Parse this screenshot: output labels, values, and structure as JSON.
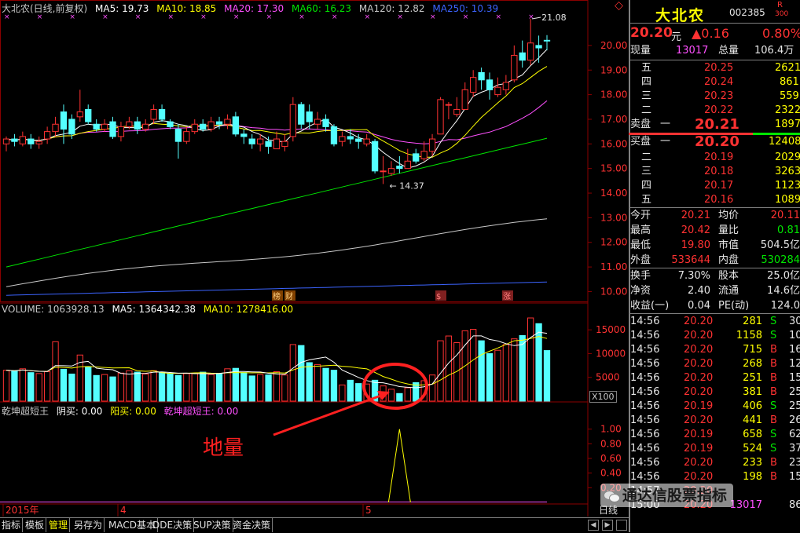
{
  "header": {
    "title": "大北农(日线,前复权)",
    "ma5": "MA5: 19.73",
    "ma10": "MA10: 18.85",
    "ma20": "MA20: 17.30",
    "ma60": "MA60: 16.23",
    "ma120": "MA120: 12.82",
    "ma250": "MA250: 10.39",
    "colors": {
      "ma5": "#ffffff",
      "ma10": "#ffff00",
      "ma20": "#ff50ff",
      "ma60": "#00e600",
      "ma120": "#c8c8c8",
      "ma250": "#3c64ff"
    }
  },
  "price_axis": [
    "20.00",
    "19.00",
    "18.00",
    "17.00",
    "16.00",
    "15.00",
    "14.00",
    "13.00",
    "12.00",
    "11.00",
    "10.00"
  ],
  "price_annotations": {
    "high": "21.08",
    "low": "14.37"
  },
  "event_markers": [
    "榜",
    "财",
    "$",
    "涨"
  ],
  "volume_header": {
    "label": "VOLUME: 1063928.13",
    "ma5": "MA5: 1364342.38",
    "ma10": "MA10: 1278416.00"
  },
  "volume_axis": [
    "15000",
    "10000",
    "5000"
  ],
  "volume_unit": "X100",
  "indicator_header": {
    "name": "乾坤超短王",
    "yinmai": "阴买: 0.00",
    "yangmai": "阳买: 0.00",
    "wang": "乾坤超短王: 0.00"
  },
  "indicator_axis": [
    "1.00",
    "0.80",
    "0.60",
    "0.40",
    "0.20"
  ],
  "annotation_text": "地量",
  "time_axis": [
    "2015年",
    "4",
    "5"
  ],
  "period_label": "日线",
  "tabs": [
    "指标",
    "模板",
    "管理",
    "另存为",
    "MACD基本",
    "DDE决策",
    "SUP决策",
    "资金决策"
  ],
  "stock": {
    "name": "大北农",
    "code": "002385",
    "badge_top": "R",
    "badge_bottom": "300",
    "price": "20.20",
    "price_unit": "元",
    "change": "▲0.16",
    "pct": "0.80%"
  },
  "volume_row": {
    "label1": "现量",
    "val1": "13017",
    "label2": "总量",
    "val2": "106.4万"
  },
  "asks": [
    {
      "label": "五",
      "price": "20.25",
      "vol": "2621"
    },
    {
      "label": "四",
      "price": "20.24",
      "vol": "861"
    },
    {
      "label": "三",
      "price": "20.23",
      "vol": "559"
    },
    {
      "label": "二",
      "price": "20.22",
      "vol": "2322"
    },
    {
      "label": "一",
      "price": "20.21",
      "vol": "1897",
      "side": "卖盘"
    }
  ],
  "bids": [
    {
      "label": "一",
      "price": "20.20",
      "vol": "12408",
      "side": "买盘"
    },
    {
      "label": "二",
      "price": "20.19",
      "vol": "2029"
    },
    {
      "label": "三",
      "price": "20.18",
      "vol": "3263"
    },
    {
      "label": "四",
      "price": "20.17",
      "vol": "1123"
    },
    {
      "label": "五",
      "price": "20.16",
      "vol": "1089"
    }
  ],
  "stats": [
    {
      "l1": "今开",
      "v1": "20.21",
      "c1": "red",
      "l2": "均价",
      "v2": "20.11",
      "c2": "red"
    },
    {
      "l1": "最高",
      "v1": "20.42",
      "c1": "red",
      "l2": "量比",
      "v2": "0.81",
      "c2": "grn"
    },
    {
      "l1": "最低",
      "v1": "19.80",
      "c1": "red",
      "l2": "市值",
      "v2": "504.5亿",
      "c2": "wht"
    },
    {
      "l1": "外盘",
      "v1": "533644",
      "c1": "red",
      "l2": "内盘",
      "v2": "530284",
      "c2": "grn"
    }
  ],
  "stats2": [
    {
      "l1": "换手",
      "v1": "7.30%",
      "l2": "股本",
      "v2": "25.0亿"
    },
    {
      "l1": "净资",
      "v1": "2.40",
      "l2": "流通",
      "v2": "14.6亿"
    },
    {
      "l1": "收益(一)",
      "v1": "0.04",
      "l2": "PE(动)",
      "v2": "124.0"
    }
  ],
  "ticks": [
    {
      "t": "14:56",
      "p": "20.20",
      "v": "281",
      "s": "S",
      "n": "30"
    },
    {
      "t": "14:56",
      "p": "20.20",
      "v": "1158",
      "s": "S",
      "n": "10"
    },
    {
      "t": "14:56",
      "p": "20.20",
      "v": "715",
      "s": "B",
      "n": "16"
    },
    {
      "t": "14:56",
      "p": "20.20",
      "v": "268",
      "s": "B",
      "n": "12"
    },
    {
      "t": "14:56",
      "p": "20.20",
      "v": "251",
      "s": "B",
      "n": "15"
    },
    {
      "t": "14:56",
      "p": "20.20",
      "v": "381",
      "s": "B",
      "n": "25"
    },
    {
      "t": "14:56",
      "p": "20.19",
      "v": "406",
      "s": "S",
      "n": "25"
    },
    {
      "t": "14:56",
      "p": "20.20",
      "v": "441",
      "s": "B",
      "n": "26"
    },
    {
      "t": "14:56",
      "p": "20.19",
      "v": "658",
      "s": "S",
      "n": "62"
    },
    {
      "t": "14:56",
      "p": "20.19",
      "v": "524",
      "s": "S",
      "n": "37"
    },
    {
      "t": "14:56",
      "p": "20.20",
      "v": "233",
      "s": "B",
      "n": "23"
    },
    {
      "t": "14:56",
      "p": "20.20",
      "v": "198",
      "s": "B",
      "n": "15"
    },
    {
      "t": "14:57",
      "p": "20.20",
      "v": "",
      "s": "",
      "n": ""
    },
    {
      "t": "15:00",
      "p": "20.20",
      "v": "13017",
      "s": "",
      "n": "864"
    }
  ],
  "watermark": "通达信股票指标",
  "chart_data": {
    "type": "candlestick",
    "ylim": [
      9.6,
      21.4
    ],
    "candles": [
      [
        16.0,
        16.2,
        16.3,
        15.7
      ],
      [
        16.2,
        16.1,
        16.4,
        15.9
      ],
      [
        16.0,
        16.3,
        16.5,
        15.9
      ],
      [
        16.2,
        16.0,
        16.4,
        15.8
      ],
      [
        16.0,
        16.1,
        16.3,
        15.8
      ],
      [
        16.2,
        16.5,
        16.7,
        16.0
      ],
      [
        16.5,
        16.8,
        17.1,
        16.3
      ],
      [
        17.3,
        16.6,
        17.6,
        16.0
      ],
      [
        17.0,
        16.4,
        17.2,
        16.2
      ],
      [
        17.1,
        17.3,
        18.2,
        16.9
      ],
      [
        17.4,
        16.9,
        17.6,
        16.8
      ],
      [
        16.8,
        16.6,
        17.0,
        16.5
      ],
      [
        16.6,
        16.8,
        17.0,
        16.5
      ],
      [
        16.9,
        16.3,
        17.1,
        16.2
      ],
      [
        16.3,
        16.7,
        16.9,
        16.1
      ],
      [
        16.7,
        16.9,
        17.1,
        16.6
      ],
      [
        16.9,
        16.6,
        17.1,
        16.4
      ],
      [
        16.6,
        16.8,
        17.0,
        16.5
      ],
      [
        17.0,
        17.4,
        17.6,
        16.8
      ],
      [
        17.4,
        17.0,
        17.6,
        16.9
      ],
      [
        16.9,
        16.7,
        17.0,
        16.6
      ],
      [
        16.6,
        16.1,
        16.8,
        15.4
      ],
      [
        16.1,
        16.5,
        16.7,
        16.0
      ],
      [
        16.5,
        16.8,
        17.0,
        16.4
      ],
      [
        16.8,
        16.6,
        17.0,
        16.5
      ],
      [
        16.6,
        16.9,
        17.1,
        16.5
      ],
      [
        16.9,
        16.8,
        17.1,
        16.6
      ],
      [
        16.8,
        17.0,
        17.2,
        16.6
      ],
      [
        17.1,
        16.4,
        17.3,
        16.3
      ],
      [
        16.4,
        16.3,
        16.6,
        16.0
      ],
      [
        16.2,
        16.0,
        16.4,
        15.8
      ],
      [
        16.0,
        16.2,
        16.4,
        15.7
      ],
      [
        16.1,
        15.9,
        16.3,
        15.6
      ],
      [
        15.8,
        16.2,
        16.5,
        15.8
      ],
      [
        15.9,
        16.1,
        16.4,
        15.7
      ],
      [
        16.3,
        17.6,
        17.9,
        16.1
      ],
      [
        17.6,
        16.8,
        17.7,
        16.6
      ],
      [
        17.3,
        16.9,
        17.6,
        16.6
      ],
      [
        16.8,
        17.0,
        17.3,
        16.6
      ],
      [
        17.0,
        16.7,
        17.2,
        16.5
      ],
      [
        16.7,
        16.0,
        16.8,
        15.9
      ],
      [
        16.1,
        16.3,
        16.5,
        15.9
      ],
      [
        16.3,
        16.2,
        16.6,
        16.0
      ],
      [
        16.2,
        16.1,
        16.4,
        15.8
      ],
      [
        16.0,
        16.2,
        16.4,
        15.9
      ],
      [
        16.1,
        14.9,
        16.2,
        14.8
      ],
      [
        14.9,
        14.9,
        15.5,
        14.37
      ],
      [
        14.8,
        15.0,
        15.3,
        14.7
      ],
      [
        15.1,
        15.0,
        15.5,
        14.8
      ],
      [
        15.0,
        15.3,
        15.8,
        15.0
      ],
      [
        15.6,
        15.3,
        15.8,
        15.2
      ],
      [
        15.4,
        15.7,
        16.1,
        15.3
      ],
      [
        15.7,
        16.2,
        16.4,
        15.5
      ],
      [
        16.4,
        17.8,
        17.9,
        16.4
      ],
      [
        17.6,
        17.6,
        17.7,
        17.0
      ],
      [
        17.2,
        17.4,
        17.9,
        17.1
      ],
      [
        17.4,
        18.2,
        18.5,
        17.4
      ],
      [
        18.1,
        18.7,
        19.0,
        17.9
      ],
      [
        18.9,
        18.6,
        19.1,
        18.2
      ],
      [
        18.6,
        18.2,
        18.9,
        17.8
      ],
      [
        18.0,
        18.3,
        18.7,
        17.9
      ],
      [
        18.2,
        18.5,
        18.8,
        18.0
      ],
      [
        18.6,
        19.6,
        20.0,
        18.5
      ],
      [
        19.7,
        19.4,
        20.2,
        19.1
      ],
      [
        19.4,
        20.1,
        21.08,
        19.2
      ],
      [
        20.0,
        19.9,
        20.4,
        19.3
      ],
      [
        20.21,
        20.2,
        20.42,
        19.8
      ]
    ],
    "volume_ylim": [
      0,
      18000
    ],
    "volume": [
      6500,
      6300,
      6800,
      6000,
      5800,
      6200,
      12500,
      6700,
      5700,
      9700,
      7200,
      5400,
      5600,
      5100,
      5900,
      6400,
      6100,
      5700,
      6400,
      6100,
      5800,
      5400,
      5800,
      5800,
      6100,
      5600,
      5800,
      6800,
      6900,
      6000,
      5300,
      5600,
      5500,
      6200,
      5500,
      11900,
      11700,
      8100,
      7700,
      6900,
      6500,
      3400,
      4400,
      3700,
      3600,
      4400,
      3200,
      2500,
      1600,
      2800,
      3900,
      4300,
      5500,
      12700,
      13700,
      12300,
      14800,
      15100,
      12700,
      10000,
      10700,
      11900,
      13100,
      13800,
      17500,
      16300,
      10639
    ],
    "indicator_ylim": [
      0,
      1.2
    ],
    "indicator_spike_index": 48
  }
}
